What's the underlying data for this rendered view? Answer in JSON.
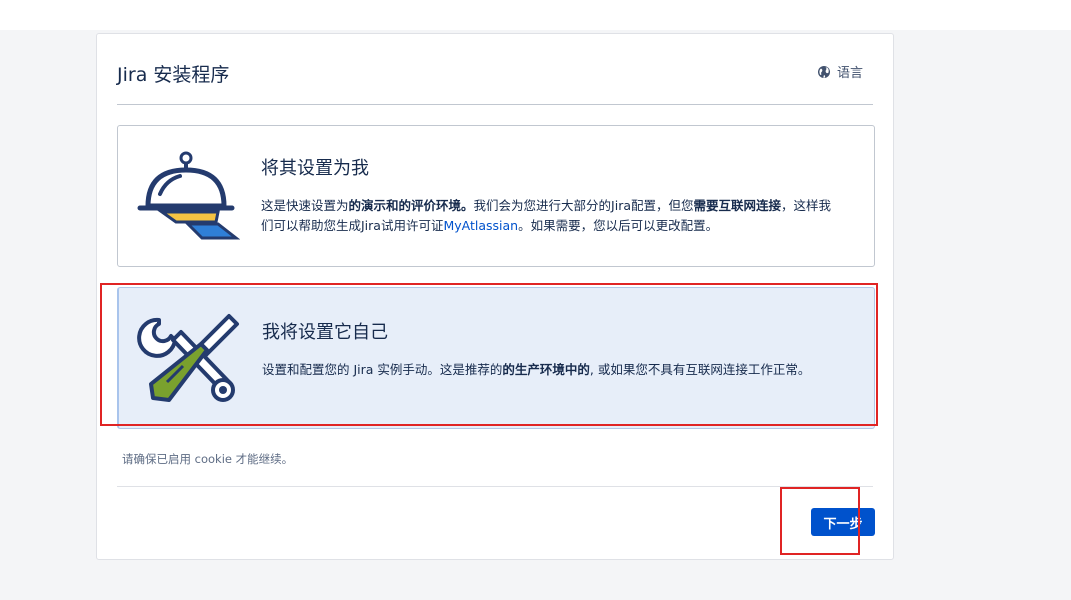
{
  "header": {
    "title": "Jira 安装程序",
    "language_label": "语言",
    "language_icon": "globe-icon"
  },
  "options": [
    {
      "id": "quick-setup",
      "icon": "serving-cloche-icon",
      "title": "将其设置为我",
      "desc": {
        "p1": "这是快速设置为",
        "b1": "的演示和的评价环境。",
        "p2": "我们会为您进行大部分的Jira配置，但您",
        "b2": "需要互联网连接",
        "p3": "，这样我们可以帮助您生成Jira试用许可证",
        "link": "MyAtlassian",
        "p4": "。如果需要，您以后可以更改配置。"
      },
      "selected": false
    },
    {
      "id": "manual-setup",
      "icon": "wrench-screwdriver-icon",
      "title": "我将设置它自己",
      "desc": {
        "p1": "设置和配置您的 Jira 实例手动。这是推荐的",
        "b1": "的生产环境中的",
        "p2": ", 或如果您不具有互联网连接工作正常。"
      },
      "selected": true
    }
  ],
  "cookie_note": "请确保已启用 cookie 才能继续。",
  "next_button": "下一步",
  "colors": {
    "primary": "#0052cc",
    "selected_bg": "#e7eef9",
    "annotation": "#e02424",
    "icon_navy": "#243b6e",
    "icon_yellow": "#f5c343",
    "icon_blue": "#2f7fd7",
    "icon_green": "#7aa12e"
  }
}
